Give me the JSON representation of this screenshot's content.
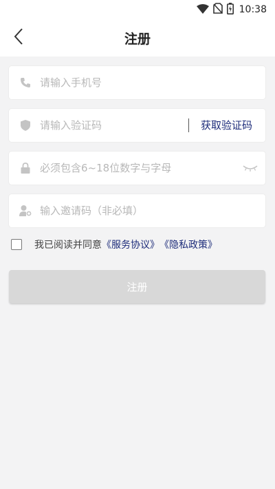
{
  "status_bar": {
    "time": "10:38",
    "icons": [
      "wifi-icon",
      "no-sim-icon",
      "battery-icon"
    ]
  },
  "header": {
    "title": "注册",
    "back_icon": "chevron-left-icon"
  },
  "form": {
    "phone": {
      "placeholder": "请输入手机号",
      "icon": "phone-icon"
    },
    "code": {
      "placeholder": "请输入验证码",
      "icon": "shield-icon",
      "action_label": "获取验证码"
    },
    "password": {
      "placeholder": "必须包含6~18位数字与字母",
      "icon": "lock-icon",
      "toggle_icon": "eye-closed-icon"
    },
    "invite": {
      "placeholder": "输入邀请码（非必填）",
      "icon": "user-key-icon"
    }
  },
  "agreement": {
    "prefix": "我已阅读并同意",
    "service_link": "《服务协议》",
    "privacy_link": "《隐私政策》"
  },
  "submit_label": "注册",
  "colors": {
    "link": "#1d2c7a",
    "button_disabled": "#d8d8d8",
    "background": "#f3f3f4"
  }
}
